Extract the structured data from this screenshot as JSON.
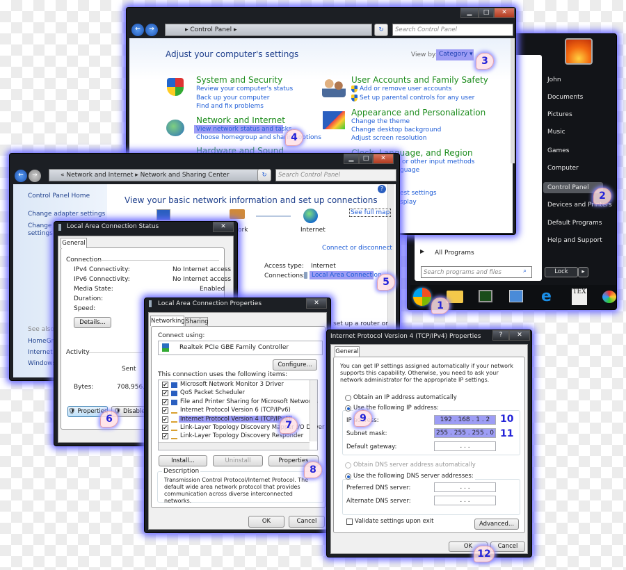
{
  "start_menu": {
    "user": "John",
    "items": [
      "Documents",
      "Pictures",
      "Music",
      "Games",
      "Computer",
      "Control Panel",
      "Devices and Printers",
      "Default Programs",
      "Help and Support"
    ],
    "all_programs": "All Programs",
    "search_placeholder": "Search programs and files",
    "lock": "Lock",
    "taskbar_icons": [
      "start-orb-icon",
      "explorer-icon",
      "monitor-icon",
      "control-panel-icon",
      "internet-explorer-icon",
      "tex-icon",
      "paint-icon"
    ]
  },
  "control_panel": {
    "breadcrumb": "Control Panel",
    "search_placeholder": "Search Control Panel",
    "heading": "Adjust your computer's settings",
    "view_by_label": "View by:",
    "view_by_value": "Category",
    "categories": [
      {
        "title": "System and Security",
        "links": [
          "Review your computer's status",
          "Back up your computer",
          "Find and fix problems"
        ]
      },
      {
        "title": "Network and Internet",
        "links": [
          "View network status and tasks",
          "Choose homegroup and sharing options"
        ]
      },
      {
        "title": "Hardware and Sound",
        "links": []
      },
      {
        "title": "User Accounts and Family Safety",
        "links": [
          "Add or remove user accounts",
          "Set up parental controls for any user"
        ]
      },
      {
        "title": "Appearance and Personalization",
        "links": [
          "Change the theme",
          "Change desktop background",
          "Adjust screen resolution"
        ]
      },
      {
        "title": "Clock, Language, and Region",
        "links": [
          "or other input methods",
          "guage",
          "est settings",
          "splay"
        ]
      }
    ]
  },
  "sharing_center": {
    "breadcrumb": [
      "Network and Internet",
      "Network and Sharing Center"
    ],
    "search_placeholder": "Search Control Panel",
    "sidebar": [
      "Control Panel Home",
      "Change adapter settings",
      "Change a",
      "settings"
    ],
    "see_also": "See also",
    "see_also_items": [
      "HomeGro",
      "Internet C",
      "Windows"
    ],
    "heading": "View your basic network information and set up connections",
    "see_full_map": "See full map",
    "network_fragment": "ork",
    "internet": "Internet",
    "connect_or_disconnect": "Connect or disconnect",
    "access_type_label": "Access type:",
    "access_type_value": "Internet",
    "connections_label": "Connections:",
    "connections_value": "Local Area Connection",
    "router_fragment": "set up a router or"
  },
  "status_dialog": {
    "title": "Local Area Connection Status",
    "tab": "General",
    "connection_label": "Connection",
    "rows": [
      {
        "label": "IPv4 Connectivity:",
        "value": "No Internet access"
      },
      {
        "label": "IPv6 Connectivity:",
        "value": "No Internet access"
      },
      {
        "label": "Media State:",
        "value": "Enabled"
      },
      {
        "label": "Duration:",
        "value": ""
      },
      {
        "label": "Speed:",
        "value": ""
      }
    ],
    "details_button": "Details...",
    "activity_label": "Activity",
    "sent_label": "Sent",
    "bytes_label": "Bytes:",
    "bytes_value": "708,956,27",
    "properties_button": "Properties",
    "disable_button": "Disable"
  },
  "properties_dialog": {
    "title": "Local Area Connection Properties",
    "tabs": [
      "Networking",
      "Sharing"
    ],
    "connect_using_label": "Connect using:",
    "adapter": "Realtek PCIe GBE Family Controller",
    "configure_button": "Configure...",
    "items_label": "This connection uses the following items:",
    "items": [
      {
        "label": "Microsoft Network Monitor 3 Driver",
        "checked": true
      },
      {
        "label": "QoS Packet Scheduler",
        "checked": true
      },
      {
        "label": "File and Printer Sharing for Microsoft Networks",
        "checked": true
      },
      {
        "label": "Internet Protocol Version 6 (TCP/IPv6)",
        "checked": true
      },
      {
        "label": "Internet Protocol Version 4 (TCP/IPv4)",
        "checked": true,
        "selected": true
      },
      {
        "label": "Link-Layer Topology Discovery Mapper I/O Driver",
        "checked": true
      },
      {
        "label": "Link-Layer Topology Discovery Responder",
        "checked": true
      }
    ],
    "install_button": "Install...",
    "uninstall_button": "Uninstall",
    "properties_button": "Properties",
    "description_label": "Description",
    "description": "Transmission Control Protocol/Internet Protocol. The default wide area network protocol that provides communication across diverse interconnected networks.",
    "ok": "OK",
    "cancel": "Cancel"
  },
  "ipv4_dialog": {
    "title": "Internet Protocol Version 4 (TCP/IPv4) Properties",
    "help": "?",
    "tab": "General",
    "intro": "You can get IP settings assigned automatically if your network supports this capability. Otherwise, you need to ask your network administrator for the appropriate IP settings.",
    "obtain_ip_auto": "Obtain an IP address automatically",
    "use_following_ip": "Use the following IP address:",
    "ip_address_label": "IP address:",
    "ip_address": "192 . 168 .  1  .  2",
    "subnet_label": "Subnet mask:",
    "subnet": "255 . 255 . 255 .  0",
    "gateway_label": "Default gateway:",
    "empty_ip": " .     .     . ",
    "obtain_dns_auto": "Obtain DNS server address automatically",
    "use_following_dns": "Use the following DNS server addresses:",
    "preferred_dns_label": "Preferred DNS server:",
    "alternate_dns_label": "Alternate DNS server:",
    "validate": "Validate settings upon exit",
    "advanced_button": "Advanced...",
    "ok": "OK",
    "cancel": "Cancel"
  },
  "steps": [
    "1",
    "2",
    "3",
    "4",
    "5",
    "6",
    "7",
    "8",
    "9",
    "10",
    "11",
    "12"
  ],
  "colors": {
    "glow": "#6b6bff",
    "highlight": "#9d9df5",
    "link": "#1c5bd6",
    "category": "#1d8c1d",
    "step_number": "#2323d8"
  }
}
